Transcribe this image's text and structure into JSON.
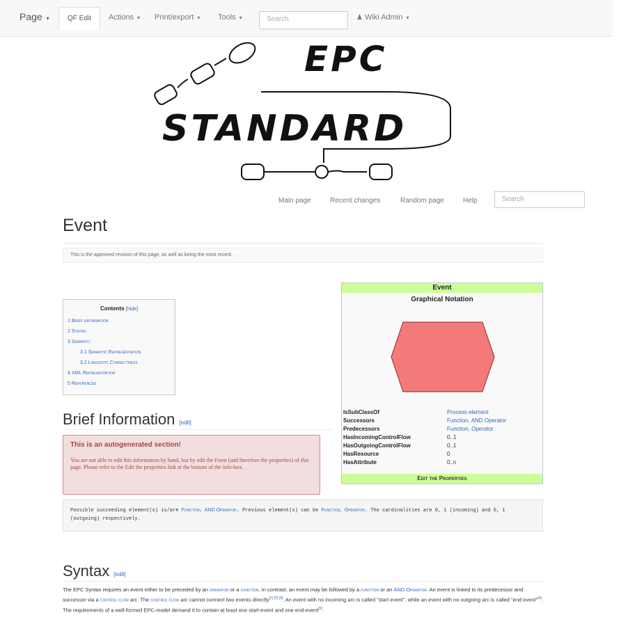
{
  "navbar": {
    "page": "Page",
    "edit": "QF Edit",
    "actions": "Actions",
    "printexport": "Print/export",
    "tools": "Tools",
    "search_placeholder": "Search",
    "user": "Wiki Admin"
  },
  "logo": {
    "line1": "EPC",
    "line2": "STANDARD"
  },
  "wikinav": {
    "main": "Main page",
    "recent": "Recent changes",
    "random": "Random page",
    "help": "Help",
    "search_placeholder": "Search"
  },
  "page": {
    "title": "Event",
    "revision_note": "This is the approved revision of this page, as well as being the most recent."
  },
  "toc": {
    "title": "Contents",
    "hide": "[hide]",
    "items": [
      "1 Brief information",
      "2 Syntax",
      "3 Semantic",
      "3.1 Semantic Representation",
      "3.2 Linguistic Correctness",
      "4 XML Representation",
      "5 References"
    ]
  },
  "infobox": {
    "header": "Event",
    "subheader": "Graphical Notation",
    "shape_color": "#f47a7a",
    "rows": [
      {
        "key": "IsSubClassOf",
        "value": "Process element"
      },
      {
        "key": "Successors",
        "value": "Function, AND Operator"
      },
      {
        "key": "Predecessors",
        "value": "Function, Operator"
      },
      {
        "key": "HasIncomingControlFlow",
        "value": "0..1"
      },
      {
        "key": "HasOutgoingControlFlow",
        "value": "0..1"
      },
      {
        "key": "HasResource",
        "value": "0"
      },
      {
        "key": "HasAttribute",
        "value": "0..n"
      }
    ],
    "footer": "Edit the Properties"
  },
  "brief": {
    "heading": "Brief Information",
    "edit": "[edit]",
    "alert_title": "This is an autogenerated section!",
    "alert_body": "You are not able to edit this information by hand, but by edit the Form (and therefore the properties) of this page. Please refer to the Edit the properties link at the bottom of the info-box."
  },
  "code": {
    "t1": "Possible succeeding element(s) is/are ",
    "l1": "Function,",
    "l2": "AND Operator",
    "t2": ". Previous element(s) can be ",
    "l3": "Function,",
    "l4": "Operator",
    "t3": ". The cardinalities are 0, 1 (incoming) and 0, 1 (outgoing) respectively."
  },
  "syntax": {
    "heading": "Syntax",
    "edit": "[edit]",
    "p1": "The EPC Syntax requires an event either to be preceded by an ",
    "l_operator": "operator",
    "p2": " or a ",
    "l_function": "function",
    "p3": ". In contrast, an event may be followed by a ",
    "l_function2": "function",
    "p4": " or an ",
    "l_and": "AND Operator",
    "p5": ". An event is linked to its predecessor and successor via a ",
    "l_cf": "control flow",
    "p6": " arc. The ",
    "l_cf2": "control flow",
    "p7": " arc cannot connect two events directly",
    "refs1": "[1] [2] [3]",
    "p8": ". An event with no incoming arc is called \"start event\", while an event with no outgoing arc is called \"end event\"",
    "refs2": "[4]",
    "p9": ". The requirements of a well-formed EPC-model demand it to contain at least one start-event and one end-event",
    "refs3": "[5]",
    "p10": "."
  }
}
